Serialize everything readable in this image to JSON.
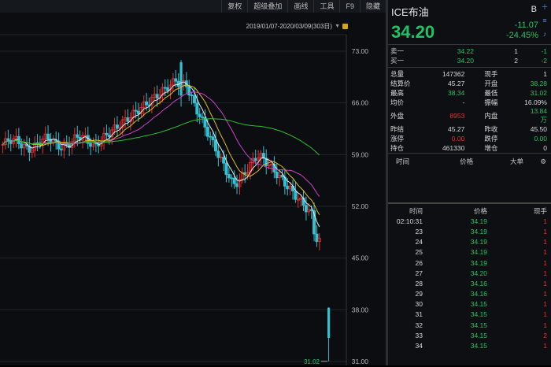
{
  "toolbar": {
    "items": [
      "复权",
      "超级叠加",
      "画线",
      "工具",
      "F9",
      "隐藏"
    ]
  },
  "range_label": "2019/01/07-2020/03/09(303日)",
  "y_ticks": [
    "73.00",
    "66.00",
    "59.00",
    "52.00",
    "45.00",
    "38.00",
    "31.00"
  ],
  "low_label": "31.02",
  "chart_data": {
    "type": "candlestick",
    "ylim": [
      31,
      73
    ],
    "up_color": "#e83030",
    "down_color": "#35c0d2",
    "ma_colors": [
      "#e8e8e8",
      "#e0c020",
      "#d040d0",
      "#30c030"
    ]
  },
  "quote": {
    "name": "ICE布油",
    "badge": "B",
    "price": "34.20",
    "change": "-11.07",
    "change_pct": "-24.45%"
  },
  "bidask": [
    {
      "label": "卖一",
      "price": "34.22",
      "vol": "1",
      "chg": "-1"
    },
    {
      "label": "买一",
      "price": "34.20",
      "vol": "2",
      "chg": "-2"
    }
  ],
  "stats": [
    {
      "l1": "总量",
      "v1": "147362",
      "c1": "white",
      "l2": "现手",
      "v2": "1",
      "c2": "white"
    },
    {
      "l1": "结算价",
      "v1": "45.27",
      "c1": "white",
      "l2": "开盘",
      "v2": "38.28",
      "c2": "green"
    },
    {
      "l1": "最高",
      "v1": "38.34",
      "c1": "green",
      "l2": "最低",
      "v2": "31.02",
      "c2": "green"
    },
    {
      "l1": "均价",
      "v1": "-",
      "c1": "white",
      "l2": "振幅",
      "v2": "16.09%",
      "c2": "white"
    },
    {
      "l1": "外盘",
      "v1": "8953",
      "c1": "red",
      "l2": "内盘",
      "v2": "13.84万",
      "c2": "green"
    },
    {
      "l1": "昨结",
      "v1": "45.27",
      "c1": "white",
      "l2": "昨收",
      "v2": "45.50",
      "c2": "white"
    },
    {
      "l1": "涨停",
      "v1": "0.00",
      "c1": "red",
      "l2": "跌停",
      "v2": "0.00",
      "c2": "green"
    },
    {
      "l1": "持仓",
      "v1": "461330",
      "c1": "white",
      "l2": "增仓",
      "v2": "0",
      "c2": "white"
    }
  ],
  "tick_header": [
    "时间",
    "价格",
    "大单"
  ],
  "trade_header": [
    "时间",
    "价格",
    "现手"
  ],
  "trades": [
    {
      "time": "02:10:31",
      "price": "34.19",
      "vol": "1"
    },
    {
      "time": "23",
      "price": "34.19",
      "vol": "1"
    },
    {
      "time": "24",
      "price": "34.19",
      "vol": "1"
    },
    {
      "time": "25",
      "price": "34.19",
      "vol": "1"
    },
    {
      "time": "26",
      "price": "34.19",
      "vol": "1"
    },
    {
      "time": "27",
      "price": "34.20",
      "vol": "1"
    },
    {
      "time": "28",
      "price": "34.16",
      "vol": "1"
    },
    {
      "time": "29",
      "price": "34.16",
      "vol": "1"
    },
    {
      "time": "30",
      "price": "34.15",
      "vol": "1"
    },
    {
      "time": "31",
      "price": "34.15",
      "vol": "1"
    },
    {
      "time": "32",
      "price": "34.15",
      "vol": "1"
    },
    {
      "time": "33",
      "price": "34.15",
      "vol": "2"
    },
    {
      "time": "34",
      "price": "34.15",
      "vol": "1"
    }
  ]
}
